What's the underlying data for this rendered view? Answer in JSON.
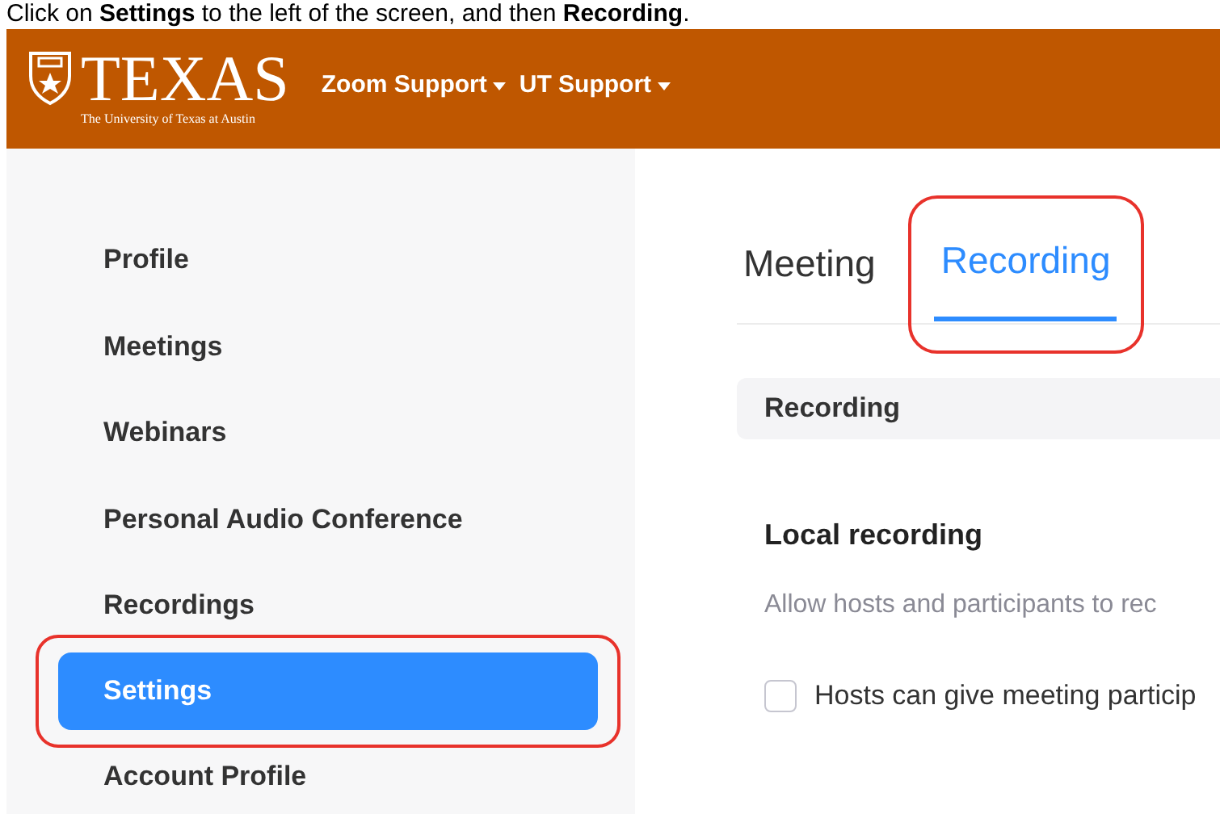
{
  "instruction": "Click on **Settings** to the left of the screen, and then **Recording**.",
  "header": {
    "wordmark": "TEXAS",
    "subtitle": "The University of Texas at Austin",
    "menus": [
      {
        "label": "Zoom Support"
      },
      {
        "label": "UT Support"
      }
    ]
  },
  "sidebar": {
    "items": [
      {
        "label": "Profile",
        "selected": false
      },
      {
        "label": "Meetings",
        "selected": false
      },
      {
        "label": "Webinars",
        "selected": false
      },
      {
        "label": "Personal Audio Conference",
        "selected": false
      },
      {
        "label": "Recordings",
        "selected": false
      },
      {
        "label": "Settings",
        "selected": true
      },
      {
        "label": "Account Profile",
        "selected": false
      }
    ]
  },
  "tabs": [
    {
      "label": "Meeting",
      "selected": false
    },
    {
      "label": "Recording",
      "selected": true
    }
  ],
  "section": {
    "title": "Recording"
  },
  "setting": {
    "title": "Local recording",
    "description": "Allow hosts and participants to rec",
    "option": {
      "label": "Hosts can give meeting particip",
      "checked": false
    }
  }
}
